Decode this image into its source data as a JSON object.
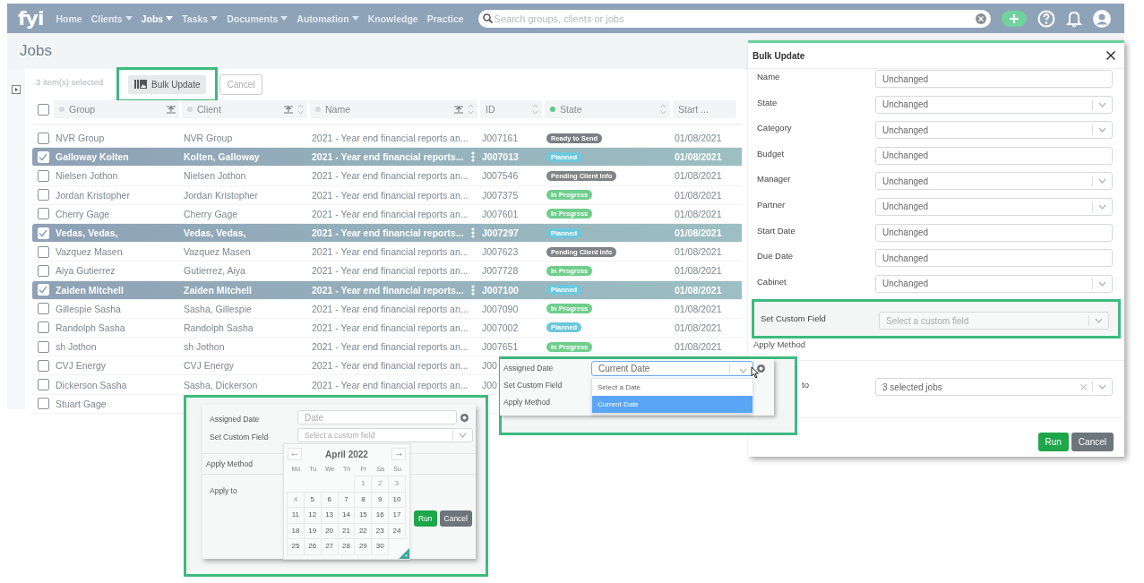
{
  "nav": {
    "logo": "fyi",
    "items": [
      {
        "label": "Home",
        "dropdown": false,
        "selected": false
      },
      {
        "label": "Clients",
        "dropdown": true,
        "selected": false
      },
      {
        "label": "Jobs",
        "dropdown": true,
        "selected": true
      },
      {
        "label": "Tasks",
        "dropdown": true,
        "selected": false
      },
      {
        "label": "Documents",
        "dropdown": true,
        "selected": false
      },
      {
        "label": "Automation",
        "dropdown": true,
        "selected": false
      },
      {
        "label": "Knowledge",
        "dropdown": false,
        "selected": false
      },
      {
        "label": "Practice",
        "dropdown": false,
        "selected": false
      }
    ],
    "search": {
      "placeholder": "Search groups, clients or jobs"
    }
  },
  "page": {
    "title": "Jobs"
  },
  "toolbar": {
    "selection": "3 item(s) selected",
    "bulk_button": {
      "label": "Bulk Update",
      "highlighted": true
    },
    "cancel_button": "Cancel"
  },
  "table": {
    "select_all": {
      "checked": false
    },
    "columns": [
      {
        "label": "Group",
        "color": "#d6d9dc",
        "filter": true,
        "sort": false
      },
      {
        "label": "Client",
        "color": "#d6d9dc",
        "filter": true,
        "sort": true
      },
      {
        "label": "Name",
        "color": "#d6d9dc",
        "filter": true,
        "sort": true
      },
      {
        "label": "ID",
        "filter": false,
        "sort": true
      },
      {
        "label": "State",
        "color": "#5cc98c",
        "filter": false,
        "sort": true
      },
      {
        "label": "Start ...",
        "filter": false,
        "sort": false
      }
    ],
    "rows": [
      {
        "selected": false,
        "group": "NVR Group",
        "client": "NVR Group",
        "name": "2021 - Year end financial reports an...",
        "id": "J007161",
        "state": {
          "label": "Ready to Send",
          "color": "#7b7f84"
        },
        "start": "01/08/2021"
      },
      {
        "selected": true,
        "group": "Galloway Kolten",
        "client": "Kolten, Galloway",
        "name": "2021 - Year end financial reports...",
        "id": "J007013",
        "state": {
          "label": "Planned",
          "color": "#6cc8dc"
        },
        "start": "01/08/2021"
      },
      {
        "selected": false,
        "group": "Nielsen Jothon",
        "client": "Nielsen Jothon",
        "name": "2021 - Year end financial reports an...",
        "id": "J007546",
        "state": {
          "label": "Pending Client Info",
          "color": "#808488"
        },
        "start": "01/08/2021"
      },
      {
        "selected": false,
        "group": "Jordan Kristopher",
        "client": "Jordan Kristopher",
        "name": "2021 - Year end financial reports an...",
        "id": "J007375",
        "state": {
          "label": "In Progress",
          "color": "#6fce8c"
        },
        "start": "01/08/2021"
      },
      {
        "selected": false,
        "group": "Cherry Gage",
        "client": "Cherry Gage",
        "name": "2021 - Year end financial reports an...",
        "id": "J007601",
        "state": {
          "label": "In Progress",
          "color": "#6fce8c"
        },
        "start": "01/08/2021"
      },
      {
        "selected": true,
        "group": "Vedas, Vedas,",
        "client": "Vedas, Vedas,",
        "name": "2021 - Year end financial reports...",
        "id": "J007297",
        "state": {
          "label": "Planned",
          "color": "#6cc8dc"
        },
        "start": "01/08/2021"
      },
      {
        "selected": false,
        "group": "Vazquez Masen",
        "client": "Vazquez Masen",
        "name": "2021 - Year end financial reports an...",
        "id": "J007623",
        "state": {
          "label": "Pending Client Info",
          "color": "#808488"
        },
        "start": "01/08/2021"
      },
      {
        "selected": false,
        "group": "Aiya Gutierrez",
        "client": "Gutierrez, Aiya",
        "name": "2021 - Year end financial reports an...",
        "id": "J007728",
        "state": {
          "label": "In Progress",
          "color": "#6fce8c"
        },
        "start": "01/08/2021"
      },
      {
        "selected": true,
        "group": "Zaiden Mitchell",
        "client": "Zaiden Mitchell",
        "name": "2021 - Year end financial reports...",
        "id": "J007100",
        "state": {
          "label": "Planned",
          "color": "#6cc8dc"
        },
        "start": "01/08/2021"
      },
      {
        "selected": false,
        "group": "Gillespie Sasha",
        "client": "Sasha, Gillespie",
        "name": "2021 - Year end financial reports an...",
        "id": "J007090",
        "state": {
          "label": "In Progress",
          "color": "#6fce8c"
        },
        "start": "01/08/2021"
      },
      {
        "selected": false,
        "group": "Randolph Sasha",
        "client": "Randolph Sasha",
        "name": "2021 - Year end financial reports an...",
        "id": "J007002",
        "state": {
          "label": "Planned",
          "color": "#6cc8dc"
        },
        "start": "01/08/2021"
      },
      {
        "selected": false,
        "group": "sh Jothon",
        "client": "sh Jothon",
        "name": "2021 - Year end financial reports an...",
        "id": "J007651",
        "state": {
          "label": "In Progress",
          "color": "#6fce8c"
        },
        "start": "01/08/2021"
      },
      {
        "selected": false,
        "group": "CVJ Energy",
        "client": "CVJ Energy",
        "name": "2021 - Year end financial reports an...",
        "id": "J00"
      },
      {
        "selected": false,
        "group": "Dickerson Sasha",
        "client": "Sasha, Dickerson",
        "name": "2021 - Year end financial reports an...",
        "id": "J00"
      },
      {
        "selected": false,
        "group": "Stuart Gage"
      }
    ]
  },
  "bulk_panel": {
    "title": "Bulk Update",
    "fields": [
      {
        "label": "Name",
        "kind": "text",
        "value": "Unchanged"
      },
      {
        "label": "State",
        "kind": "select",
        "value": "Unchanged"
      },
      {
        "label": "Category",
        "kind": "select",
        "value": "Unchanged"
      },
      {
        "label": "Budget",
        "kind": "text",
        "value": "Unchanged"
      },
      {
        "label": "Manager",
        "kind": "select",
        "value": "Unchanged"
      },
      {
        "label": "Partner",
        "kind": "select",
        "value": "Unchanged"
      },
      {
        "label": "Start Date",
        "kind": "text",
        "value": "Unchanged"
      },
      {
        "label": "Due Date",
        "kind": "text",
        "value": "Unchanged"
      },
      {
        "label": "Cabinet",
        "kind": "select",
        "value": "Unchanged"
      }
    ],
    "custom_field": {
      "label": "Set Custom Field",
      "placeholder": "Select a custom field",
      "highlighted": true
    },
    "apply_method": "Apply Method",
    "apply_to": {
      "label": "to",
      "value": "3 selected jobs"
    },
    "buttons": [
      {
        "label": "Run",
        "kind": "primary"
      },
      {
        "label": "Cancel",
        "kind": "secondary"
      }
    ]
  },
  "dropdown_inset": {
    "assigned_label": "Assigned Date",
    "value": "Current Date",
    "custom_label": "Set Custom Field",
    "options": [
      {
        "label": "Select a Date",
        "selected": false
      },
      {
        "label": "Current Date",
        "selected": true
      }
    ],
    "apply_method": "Apply Method"
  },
  "calendar_inset": {
    "assigned_label": "Assigned Date",
    "placeholder": "Date",
    "custom_label": "Set Custom Field",
    "custom_placeholder": "Select a custom field",
    "apply_method": "Apply Method",
    "apply_to": "Apply to",
    "buttons": [
      {
        "label": "Run",
        "kind": "primary"
      },
      {
        "label": "Cancel",
        "kind": "secondary"
      }
    ],
    "calendar": {
      "month": "April 2022",
      "prev": "←",
      "next": "→",
      "weekdays": [
        "Mo",
        "Tu",
        "We",
        "Th",
        "Fr",
        "Sa",
        "Su"
      ],
      "weeks": [
        [
          {
            "kind": "blank"
          },
          {
            "kind": "blank"
          },
          {
            "kind": "blank"
          },
          {
            "kind": "blank"
          },
          {
            "label": "1",
            "disabled": true
          },
          {
            "label": "2",
            "disabled": true
          },
          {
            "label": "3",
            "disabled": true
          }
        ],
        [
          {
            "label": "4",
            "disabled": true
          },
          {
            "label": "5",
            "disabled": false
          },
          {
            "label": "6",
            "disabled": false
          },
          {
            "label": "7",
            "disabled": false
          },
          {
            "label": "8",
            "disabled": false
          },
          {
            "label": "9",
            "disabled": false
          },
          {
            "label": "10",
            "disabled": false
          }
        ],
        [
          {
            "label": "11",
            "disabled": false
          },
          {
            "label": "12",
            "disabled": false
          },
          {
            "label": "13",
            "disabled": false
          },
          {
            "label": "14",
            "disabled": false
          },
          {
            "label": "15",
            "disabled": false
          },
          {
            "label": "16",
            "disabled": false
          },
          {
            "label": "17",
            "disabled": false
          }
        ],
        [
          {
            "label": "18",
            "disabled": false
          },
          {
            "label": "19",
            "disabled": false
          },
          {
            "label": "20",
            "disabled": false
          },
          {
            "label": "21",
            "disabled": false
          },
          {
            "label": "22",
            "disabled": false
          },
          {
            "label": "23",
            "disabled": false
          },
          {
            "label": "24",
            "disabled": false
          }
        ],
        [
          {
            "label": "25",
            "disabled": false
          },
          {
            "label": "26",
            "disabled": false
          },
          {
            "label": "27",
            "disabled": false
          },
          {
            "label": "28",
            "disabled": false
          },
          {
            "label": "29",
            "disabled": false
          },
          {
            "label": "30",
            "disabled": false
          },
          {
            "kind": "blank"
          }
        ]
      ]
    }
  }
}
